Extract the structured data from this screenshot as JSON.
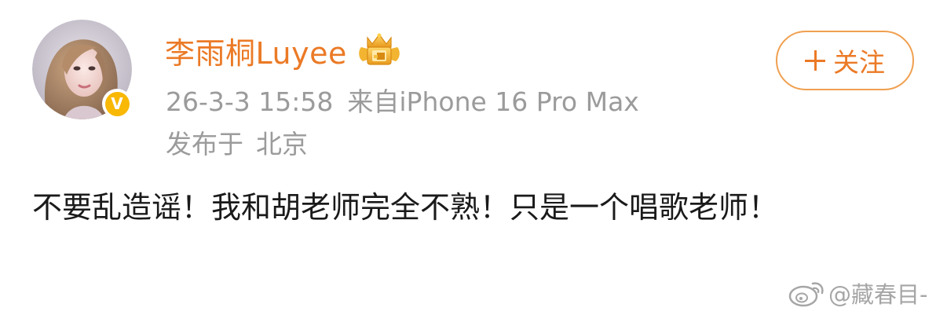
{
  "author": {
    "name": "李雨桐Luyee",
    "verified_mark": "V",
    "avatar_icon": "avatar-photo",
    "badge_icon": "crown-badge-icon",
    "name_color": "#eb7a26"
  },
  "meta": {
    "timestamp": "26-3-3 15:58",
    "source": "来自iPhone 16 Pro Max",
    "location_prefix": "发布于",
    "location": "北京"
  },
  "follow_button": {
    "label": "关注",
    "icon": "plus-icon"
  },
  "post": {
    "text": "不要乱造谣！我和胡老师完全不熟！只是一个唱歌老师！"
  },
  "watermark": {
    "text": "@藏春目-",
    "icon": "weibo-logo-icon"
  },
  "colors": {
    "accent": "#eb7a26",
    "verified": "#f8b803",
    "meta_gray": "#9b9b9b",
    "text": "#1a1a1a"
  }
}
